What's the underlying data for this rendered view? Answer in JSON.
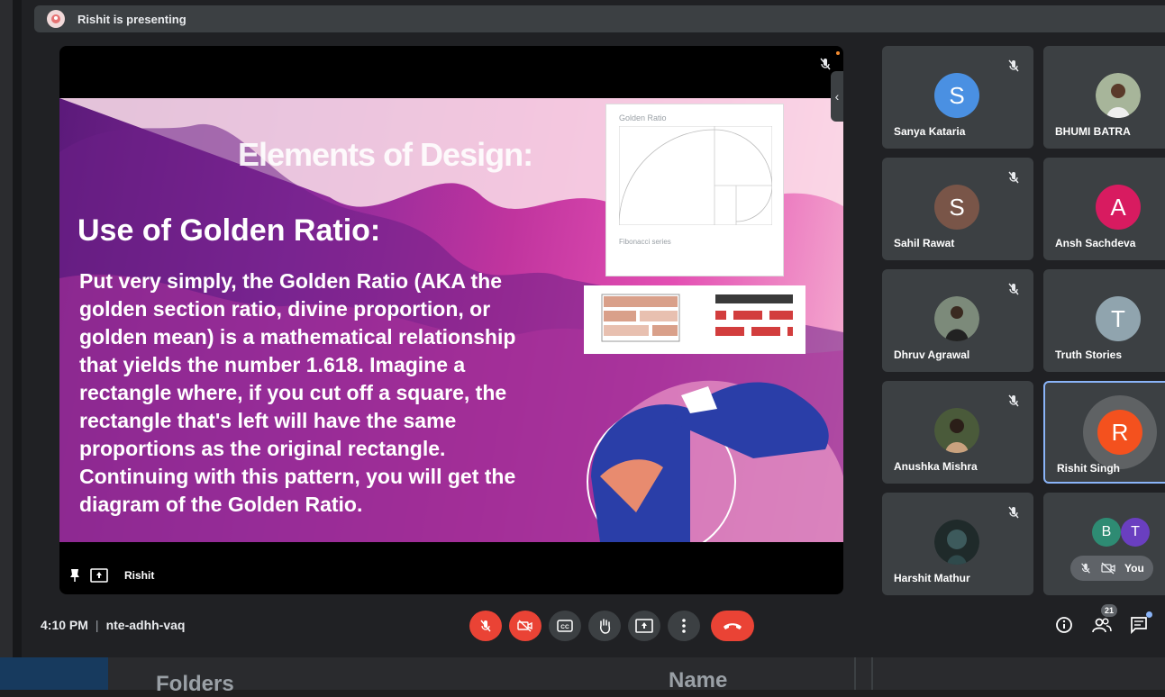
{
  "presenting_bar": {
    "text": "Rishit is presenting"
  },
  "main_tile": {
    "presenter_name": "Rishit",
    "slide": {
      "title": "Elements of Design:",
      "heading": "Use of Golden Ratio:",
      "body": "Put very simply, the Golden Ratio (AKA the golden section ratio, divine proportion, or golden mean) is a mathematical relationship that yields the number 1.618. Imagine a rectangle where, if you cut off a square, the rectangle that's left will have the same proportions as the original rectangle. Continuing with this pattern, you will get the diagram of the Golden Ratio.",
      "golden_label": "Golden Ratio",
      "fib_label": "Fibonacci series"
    }
  },
  "participants": [
    {
      "name": "Sanya Kataria",
      "initial": "S",
      "color": "#4a90e2"
    },
    {
      "name": "BHUMI BATRA",
      "initial": "",
      "color": "#8d9b7a"
    },
    {
      "name": "Sahil Rawat",
      "initial": "S",
      "color": "#795548"
    },
    {
      "name": "Ansh Sachdeva",
      "initial": "A",
      "color": "#d81b60"
    },
    {
      "name": "Dhruv Agrawal",
      "initial": "",
      "color": "#6b7a6a"
    },
    {
      "name": "Truth Stories",
      "initial": "T",
      "color": "#90a4ae"
    },
    {
      "name": "Anushka Mishra",
      "initial": "",
      "color": "#4a5a3a"
    },
    {
      "name": "Rishit Singh",
      "initial": "R",
      "color": "#f4511e"
    },
    {
      "name": "Harshit Mathur",
      "initial": "",
      "color": "#2f3b3a"
    }
  ],
  "self_tile": {
    "label": "You",
    "mini_avatars": [
      {
        "initial": "B",
        "color": "#2e8b73"
      },
      {
        "initial": "T",
        "color": "#6a3fc0"
      }
    ]
  },
  "controls": {
    "time": "4:10 PM",
    "meeting_code": "nte-adhh-vaq",
    "people_count": "21"
  },
  "background": {
    "folders_label": "Folders",
    "name_label": "Name"
  }
}
